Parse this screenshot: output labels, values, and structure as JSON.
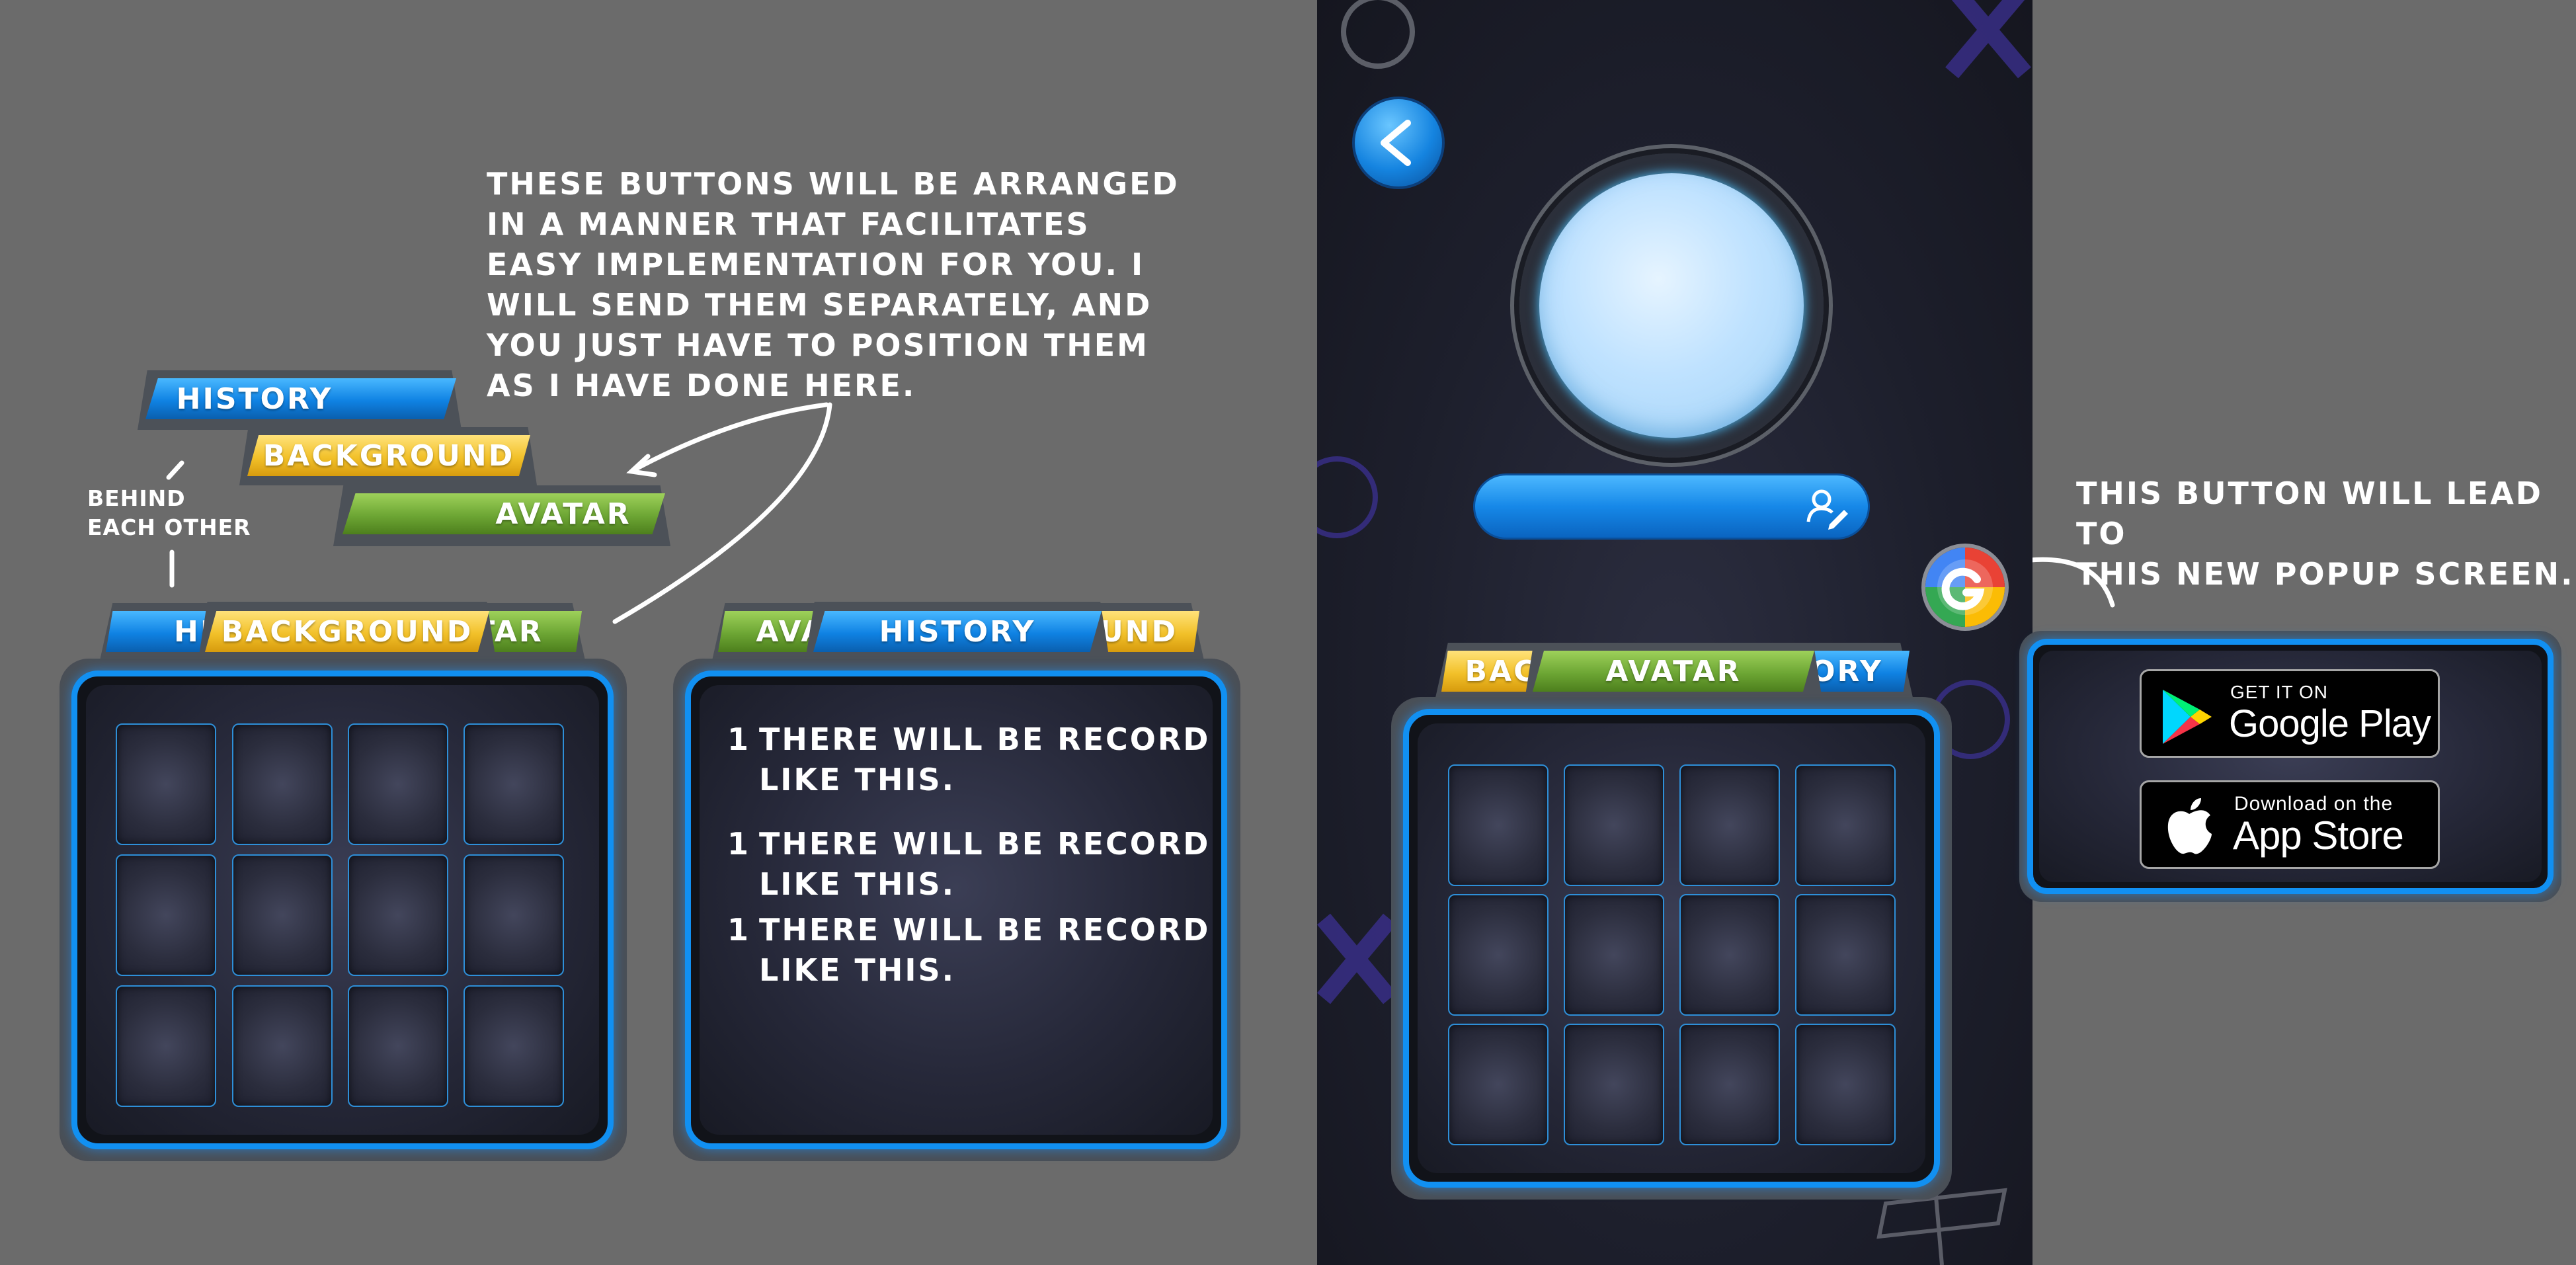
{
  "notes": {
    "arranged": "THESE BUTTONS WILL BE ARRANGED\nIN A MANNER THAT FACILITATES\nEASY IMPLEMENTATION FOR YOU. I\nWILL SEND THEM SEPARATELY, AND\nYOU JUST HAVE TO POSITION THEM\nAS I HAVE DONE HERE.",
    "behind": "BEHIND\nEACH OTHER",
    "popup": "THIS BUTTON WILL LEAD TO\nTHIS NEW POPUP SCREEN."
  },
  "separate_tabs": {
    "history": "HISTORY",
    "background": "BACKGROUND",
    "avatar": "AVATAR"
  },
  "panel_left": {
    "tab_back_left": "HIS",
    "tab_front": "BACKGROUND",
    "tab_back_right": "TAR"
  },
  "panel_middle": {
    "tab_back_left": "AVA",
    "tab_front": "HISTORY",
    "tab_back_right": "UND",
    "records": [
      {
        "num": "1",
        "line1": "THERE WILL BE RECORD",
        "line2": "LIKE THIS."
      },
      {
        "num": "1",
        "line1": "THERE WILL BE RECORD",
        "line2": "LIKE THIS."
      },
      {
        "num": "1",
        "line1": "THERE WILL BE RECORD",
        "line2": "LIKE THIS."
      }
    ]
  },
  "phone": {
    "back_icon": "chevron-left-icon",
    "name_field_icon": "user-edit-icon",
    "tab_back_left": "BAC",
    "tab_front": "AVATAR",
    "tab_back_right": "ORY"
  },
  "popup": {
    "google_play_small": "GET IT ON",
    "google_play_big": "Google Play",
    "app_store_small": "Download on the",
    "app_store_big": "App Store"
  },
  "colors": {
    "background": "#6b6b6b",
    "blue_tab": "#1189ea",
    "yellow_tab": "#f2c12a",
    "green_tab": "#6da634",
    "panel_glow": "#1190f2"
  }
}
